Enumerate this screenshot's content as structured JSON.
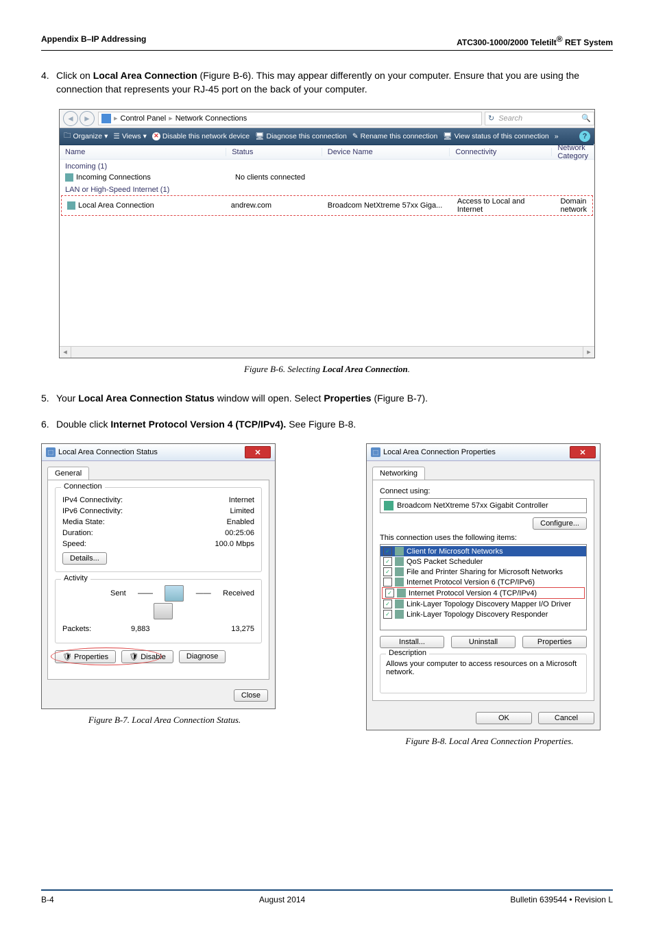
{
  "header": {
    "left": "Appendix B–IP Addressing",
    "right_pre": "ATC300-1000/2000 Teletilt",
    "right_sup": "®",
    "right_post": " RET System"
  },
  "step4": {
    "num": "4.",
    "text_a": "Click on ",
    "bold_a": "Local Area Connection",
    "text_b": " (Figure B-6). This may appear differently on your computer. Ensure that you are using the connection that represents your RJ-45 port on the back of your computer."
  },
  "figb6": {
    "breadcrumb": {
      "cp": "Control Panel",
      "nc": "Network Connections"
    },
    "search_placeholder": "Search",
    "cmd": {
      "organize": "Organize",
      "views": "Views",
      "disable": "Disable this network device",
      "diagnose": "Diagnose this connection",
      "rename": "Rename this connection",
      "viewstatus": "View status of this connection",
      "more": "»"
    },
    "cols": {
      "name": "Name",
      "status": "Status",
      "device": "Device Name",
      "conn": "Connectivity",
      "cat": "Network Category"
    },
    "grp1": "Incoming (1)",
    "row1": {
      "name": "Incoming Connections",
      "status": "No clients connected"
    },
    "grp2": "LAN or High-Speed Internet (1)",
    "row2": {
      "name": "Local Area Connection",
      "status": "andrew.com",
      "device": "Broadcom NetXtreme 57xx Giga...",
      "conn": "Access to Local and Internet",
      "cat": "Domain network"
    },
    "caption_a": "Figure B-6.  Selecting ",
    "caption_b": "Local Area Connection",
    "caption_c": "."
  },
  "step5": {
    "num": "5.",
    "a": "Your ",
    "b": "Local Area Connection Status",
    "c": " window will open. Select ",
    "d": "Properties",
    "e": " (Figure B-7)."
  },
  "step6": {
    "num": "6.",
    "a": "Double click ",
    "b": "Internet Protocol Version 4 (TCP/IPv4).",
    "c": " See Figure B-8."
  },
  "figb7": {
    "title": "Local Area Connection Status",
    "tab": "General",
    "fs1": "Connection",
    "ipv4c_l": "IPv4 Connectivity:",
    "ipv4c_v": "Internet",
    "ipv6c_l": "IPv6 Connectivity:",
    "ipv6c_v": "Limited",
    "media_l": "Media State:",
    "media_v": "Enabled",
    "dur_l": "Duration:",
    "dur_v": "00:25:06",
    "spd_l": "Speed:",
    "spd_v": "100.0 Mbps",
    "details": "Details...",
    "fs2": "Activity",
    "sent": "Sent",
    "recv": "Received",
    "pkt_l": "Packets:",
    "pkt_s": "9,883",
    "pkt_r": "13,275",
    "props": "Properties",
    "disable": "Disable",
    "diag": "Diagnose",
    "close": "Close",
    "caption": "Figure B-7.  Local Area Connection Status."
  },
  "figb8": {
    "title": "Local Area Connection Properties",
    "tab": "Networking",
    "connect_using": "Connect using:",
    "adapter": "Broadcom NetXtreme 57xx Gigabit Controller",
    "configure": "Configure...",
    "uses": "This connection uses the following items:",
    "items": [
      {
        "chk": true,
        "sel": true,
        "txt": "Client for Microsoft Networks"
      },
      {
        "chk": true,
        "txt": "QoS Packet Scheduler"
      },
      {
        "chk": true,
        "txt": "File and Printer Sharing for Microsoft Networks"
      },
      {
        "chk": false,
        "txt": "Internet Protocol Version 6 (TCP/IPv6)"
      },
      {
        "chk": true,
        "hl": true,
        "txt": "Internet Protocol Version 4 (TCP/IPv4)"
      },
      {
        "chk": true,
        "txt": "Link-Layer Topology Discovery Mapper I/O Driver"
      },
      {
        "chk": true,
        "txt": "Link-Layer Topology Discovery Responder"
      }
    ],
    "install": "Install...",
    "uninstall": "Uninstall",
    "props": "Properties",
    "desc_l": "Description",
    "desc_t": "Allows your computer to access resources on a Microsoft network.",
    "ok": "OK",
    "cancel": "Cancel",
    "caption": "Figure B-8.  Local Area Connection Properties."
  },
  "footer": {
    "left": "B-4",
    "center": "August 2014",
    "right": "Bulletin 639544  •  Revision L"
  }
}
